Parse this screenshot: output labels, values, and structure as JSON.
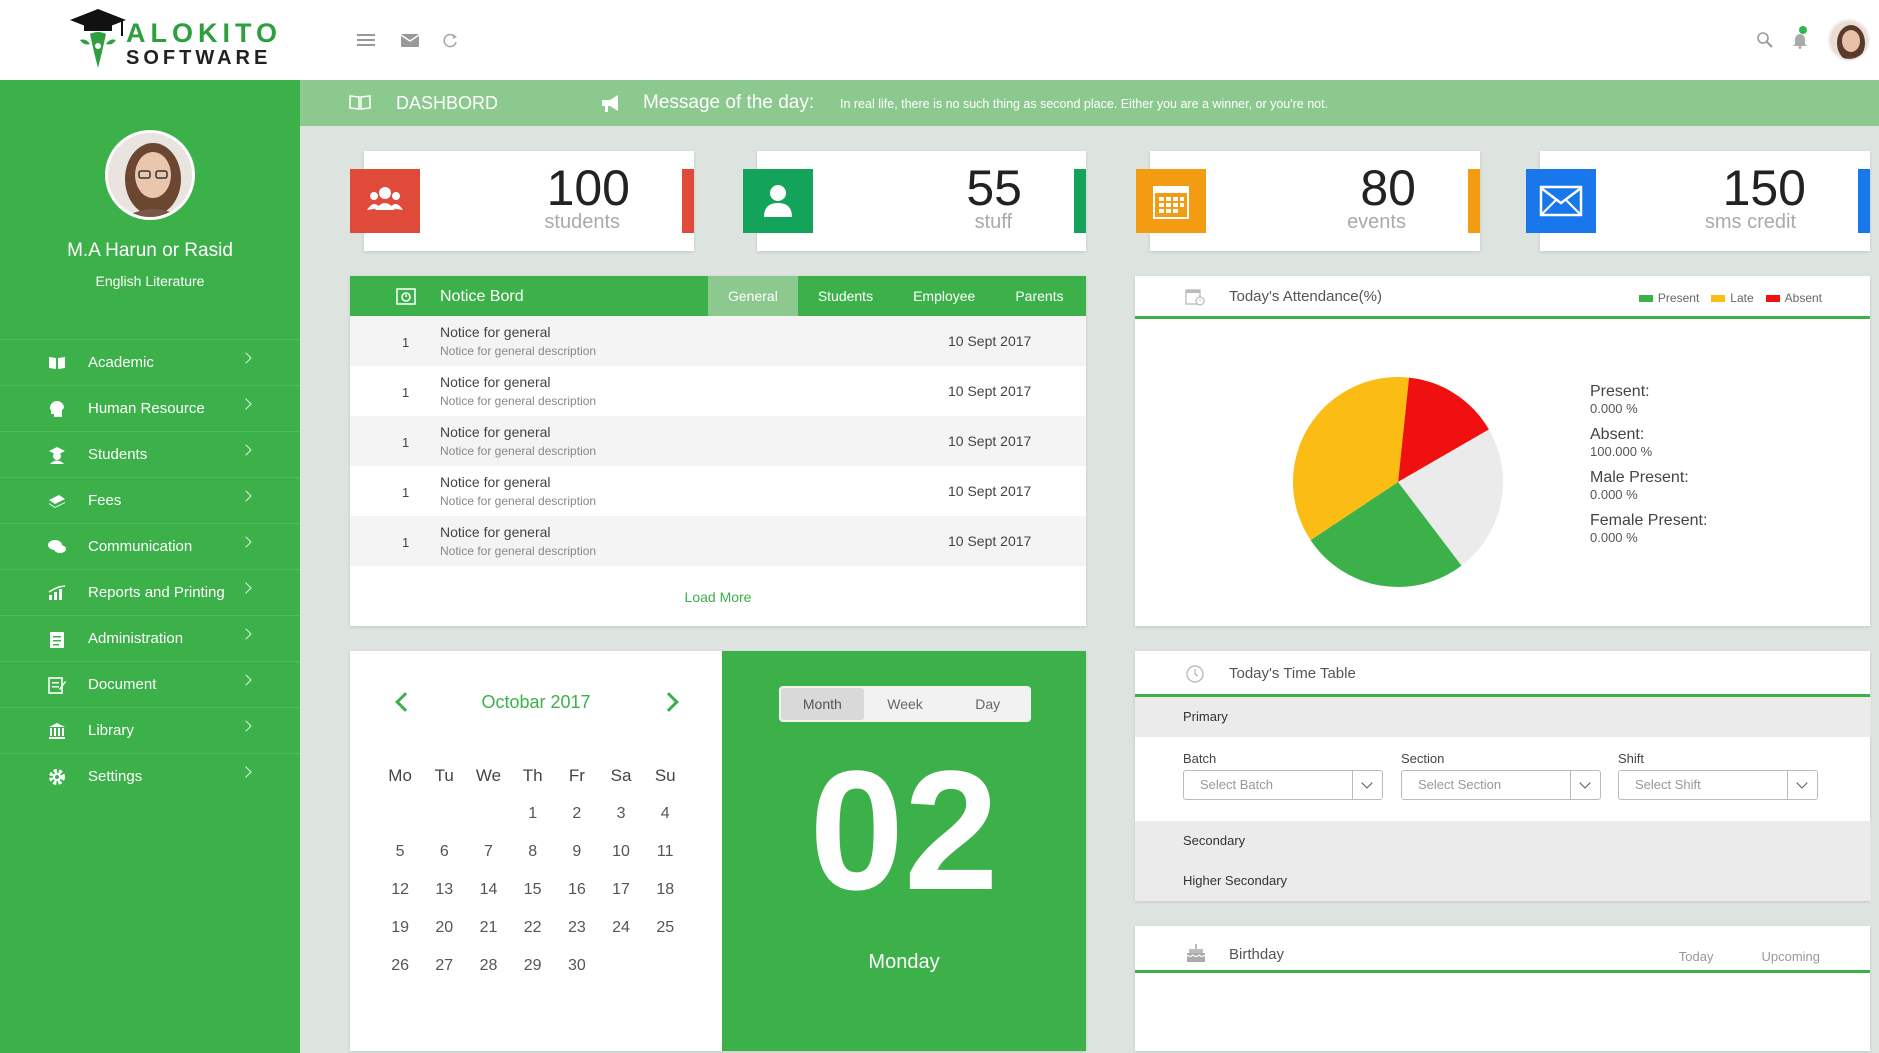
{
  "brand": {
    "line1": "ALOKITO",
    "line2": "SOFTWARE",
    "accent": "#3cb14a"
  },
  "profile": {
    "name": "M.A Harun or Rasid",
    "subtitle": "English Literature"
  },
  "menu": [
    {
      "label": "Academic",
      "icon": "book-icon"
    },
    {
      "label": "Human Resource",
      "icon": "head-icon"
    },
    {
      "label": "Students",
      "icon": "student-icon"
    },
    {
      "label": "Fees",
      "icon": "money-icon"
    },
    {
      "label": "Communication",
      "icon": "chat-icon"
    },
    {
      "label": "Reports and Printing",
      "icon": "chart-icon"
    },
    {
      "label": "Administration",
      "icon": "clipboard-icon"
    },
    {
      "label": "Document",
      "icon": "document-icon"
    },
    {
      "label": "Library",
      "icon": "library-icon"
    },
    {
      "label": "Settings",
      "icon": "gear-icon"
    }
  ],
  "subheader": {
    "title": "DASHBORD",
    "message_label": "Message of the day:",
    "message": "In real life, there is no such thing as second place. Either you are a winner, or you're not."
  },
  "stats": [
    {
      "value": "100",
      "label": "students",
      "color": "#e04a3a",
      "icon": "users-icon"
    },
    {
      "value": "55",
      "label": "stuff",
      "color": "#14a35a",
      "icon": "user-icon"
    },
    {
      "value": "80",
      "label": "events",
      "color": "#f39c12",
      "icon": "calendar-icon"
    },
    {
      "value": "150",
      "label": "sms credit",
      "color": "#1877ea",
      "icon": "envelope-icon"
    }
  ],
  "notice_board": {
    "title": "Notice Bord",
    "tabs": [
      "General",
      "Students",
      "Employee",
      "Parents"
    ],
    "active_tab": "General",
    "rows": [
      {
        "num": "1",
        "title": "Notice for general",
        "desc": "Notice for general description",
        "date": "10 Sept 2017"
      },
      {
        "num": "1",
        "title": "Notice for general",
        "desc": "Notice for general description",
        "date": "10 Sept 2017"
      },
      {
        "num": "1",
        "title": "Notice for general",
        "desc": "Notice for general description",
        "date": "10 Sept 2017"
      },
      {
        "num": "1",
        "title": "Notice for general",
        "desc": "Notice for general description",
        "date": "10 Sept 2017"
      },
      {
        "num": "1",
        "title": "Notice for general",
        "desc": "Notice for general description",
        "date": "10 Sept 2017"
      }
    ],
    "load_more": "Load More"
  },
  "attendance": {
    "title": "Today's Attendance(%)",
    "legend": [
      {
        "label": "Present",
        "color": "#3cb14a"
      },
      {
        "label": "Late",
        "color": "#fbbc14"
      },
      {
        "label": "Absent",
        "color": "#f01010"
      }
    ],
    "stats": [
      {
        "label": "Present:",
        "value": "0.000 %"
      },
      {
        "label": "Absent:",
        "value": "100.000 %"
      },
      {
        "label": "Male Present:",
        "value": "0.000 %"
      },
      {
        "label": "Female Present:",
        "value": "0.000 %"
      }
    ]
  },
  "chart_data": {
    "type": "pie",
    "title": "",
    "slices": [
      {
        "name": "Absent",
        "value": 15,
        "color": "#f01010"
      },
      {
        "name": "",
        "value": 23,
        "color": "#ebebeb"
      },
      {
        "name": "Present",
        "value": 26,
        "color": "#3cb14a"
      },
      {
        "name": "Late",
        "value": 36,
        "color": "#fbbc14"
      }
    ]
  },
  "calendar": {
    "month": "Octobar 2017",
    "weekdays": [
      "Mo",
      "Tu",
      "We",
      "Th",
      "Fr",
      "Sa",
      "Su"
    ],
    "weeks": [
      [
        "",
        "",
        "",
        "1",
        "2",
        "3",
        "4"
      ],
      [
        "5",
        "6",
        "7",
        "8",
        "9",
        "10",
        "11"
      ],
      [
        "12",
        "13",
        "14",
        "15",
        "16",
        "17",
        "18"
      ],
      [
        "19",
        "20",
        "21",
        "22",
        "23",
        "24",
        "25"
      ],
      [
        "26",
        "27",
        "28",
        "29",
        "30",
        "",
        ""
      ]
    ],
    "view_tabs": [
      "Month",
      "Week",
      "Day"
    ],
    "active_view": "Month",
    "day_number": "02",
    "day_name": "Monday"
  },
  "timetable": {
    "title": "Today's Time Table",
    "sections": [
      "Primary",
      "Secondary",
      "Higher Secondary"
    ],
    "fields": [
      {
        "label": "Batch",
        "placeholder": "Select Batch"
      },
      {
        "label": "Section",
        "placeholder": "Select Section"
      },
      {
        "label": "Shift",
        "placeholder": "Select Shift"
      }
    ]
  },
  "birthday": {
    "title": "Birthday",
    "tabs": [
      "Today",
      "Upcoming"
    ]
  }
}
